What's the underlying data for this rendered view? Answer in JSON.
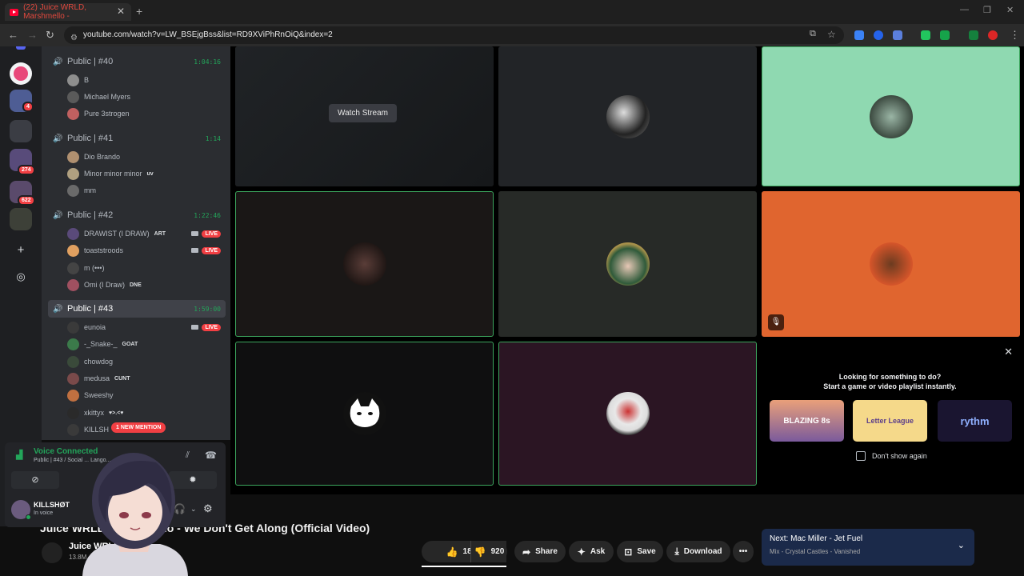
{
  "browser": {
    "tab_title": "(22) Juice WRLD, Marshmello -",
    "url": "youtube.com/watch?v=LW_BSEjgBss&list=RD9XViPhRnOiQ&index=2"
  },
  "guilds": {
    "badges": [
      "4",
      "274",
      "622"
    ]
  },
  "channels": [
    {
      "name": "Public | #40",
      "duration": "1:04:16",
      "members": [
        {
          "name": "B"
        },
        {
          "name": "Michael Myers"
        },
        {
          "name": "Pure 3strogen"
        }
      ]
    },
    {
      "name": "Public | #41",
      "duration": "1:14",
      "members": [
        {
          "name": "Dio Brando"
        },
        {
          "name": "Minor minor minor",
          "tag": "uv"
        },
        {
          "name": "mm"
        }
      ]
    },
    {
      "name": "Public | #42",
      "duration": "1:22:46",
      "members": [
        {
          "name": "DRAWIST (I DRAW)",
          "tag": "ART",
          "live": "LIVE"
        },
        {
          "name": "toaststroods",
          "live": "LIVE"
        },
        {
          "name": "m (•••)"
        },
        {
          "name": "Omi (I Draw)",
          "tag": "DNE"
        }
      ]
    },
    {
      "name": "Public | #43",
      "duration": "1:59:00",
      "members": [
        {
          "name": "eunoia",
          "live": "LIVE"
        },
        {
          "name": "-_Snake-_",
          "tag": "GOAT"
        },
        {
          "name": "chowdog"
        },
        {
          "name": "medusa",
          "tag": "CUNT"
        },
        {
          "name": "Sweeshy"
        },
        {
          "name": "xkittyx",
          "tag": "♥>.<♥"
        },
        {
          "name": "KILLSH"
        }
      ]
    }
  ],
  "mention_pill": "1 NEW MENTION",
  "voice": {
    "status": "Voice Connected",
    "channel": "Public | #43 / Social ... Lango..."
  },
  "user": {
    "name": "KILLSHØT",
    "status": "In voice"
  },
  "stage": {
    "watch_stream": "Watch Stream"
  },
  "activity": {
    "title": "Looking for something to do?",
    "subtitle": "Start a game or video playlist instantly.",
    "games": [
      "BLAZING 8s",
      "Letter League",
      "rythm"
    ],
    "dont_show": "Don't show again"
  },
  "youtube": {
    "title": "Juice WRLD, Marshmello - We Don't Get Along (Official Video)",
    "channel": "Juice WRLD",
    "subs": "13.8M",
    "likes": "186K",
    "dislikes": "920",
    "share": "Share",
    "ask": "Ask",
    "save": "Save",
    "download": "Download",
    "next_title": "Next: Mac Miller - Jet Fuel",
    "next_sub": "Mix - Crystal Castles - Vanished"
  },
  "colors": {
    "discord_green": "#23a55a",
    "live_red": "#f23f43",
    "tile_mint": "#8fd9b1",
    "tile_orange": "#e0652f"
  }
}
